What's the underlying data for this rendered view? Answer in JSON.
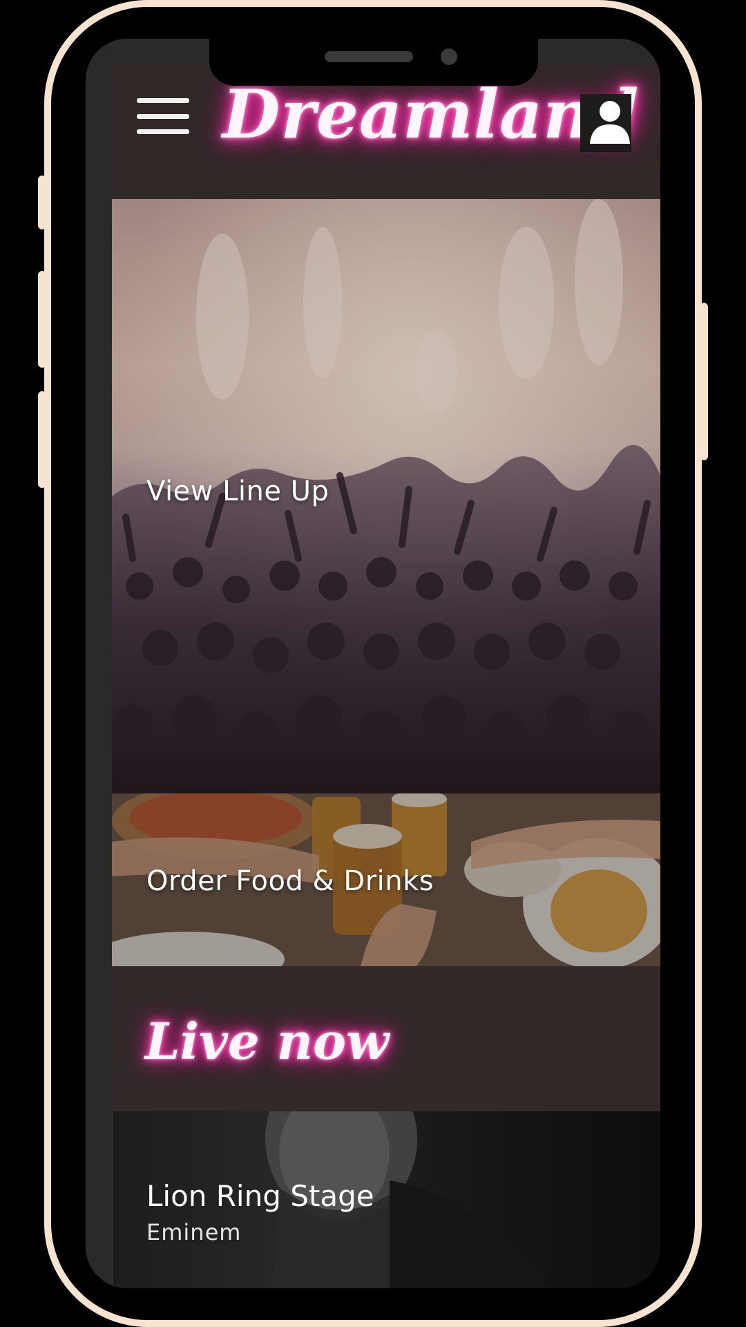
{
  "app": {
    "logo_text": "Dreamland"
  },
  "tiles": {
    "lineup_label": "View Line Up",
    "food_label": "Order Food & Drinks"
  },
  "live": {
    "heading": "Live now",
    "stage_name": "Lion Ring Stage",
    "artist": "Eminem"
  },
  "colors": {
    "frame": "#f7e3cf",
    "neon_pink": "#ff2aa6",
    "header_bg": "#312828"
  },
  "icons": {
    "menu": "hamburger-menu-icon",
    "user": "user-account-icon"
  }
}
